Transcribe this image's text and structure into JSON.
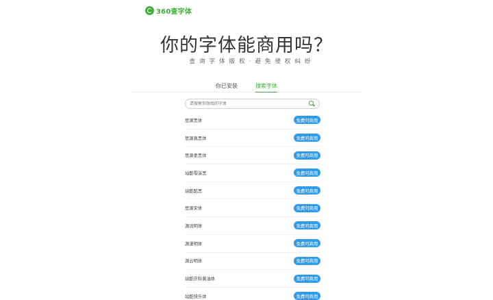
{
  "brand": {
    "logo_text": "360查字体",
    "accent_color": "#3fae3a"
  },
  "hero": {
    "title": "你的字体能商用吗？",
    "subtitle": "查询字体版权·避免侵权纠纷"
  },
  "tabs": [
    {
      "label": "你已安装",
      "active": false
    },
    {
      "label": "搜索字体",
      "active": true
    }
  ],
  "search": {
    "placeholder": "请搜索你想找的字体",
    "icon": "search-icon"
  },
  "fonts": [
    {
      "name": "思源黑体",
      "badge": "免费可商用"
    },
    {
      "name": "思源真黑体",
      "badge": "免费可商用"
    },
    {
      "name": "思源柔黑体",
      "badge": "免费可商用"
    },
    {
      "name": "站酷零演黑",
      "badge": "免费可商用"
    },
    {
      "name": "站酷酷黑",
      "badge": "免费可商用"
    },
    {
      "name": "思源宋体",
      "badge": "免费可商用"
    },
    {
      "name": "源流明体",
      "badge": "免费可商用"
    },
    {
      "name": "源漾明体",
      "badge": "免费可商用"
    },
    {
      "name": "源云明体",
      "badge": "免费可商用"
    },
    {
      "name": "站酷庆科黄油体",
      "badge": "免费可商用"
    },
    {
      "name": "站酷快乐体",
      "badge": "免费可商用"
    }
  ],
  "colors": {
    "badge_blue": "#2f9bea"
  }
}
